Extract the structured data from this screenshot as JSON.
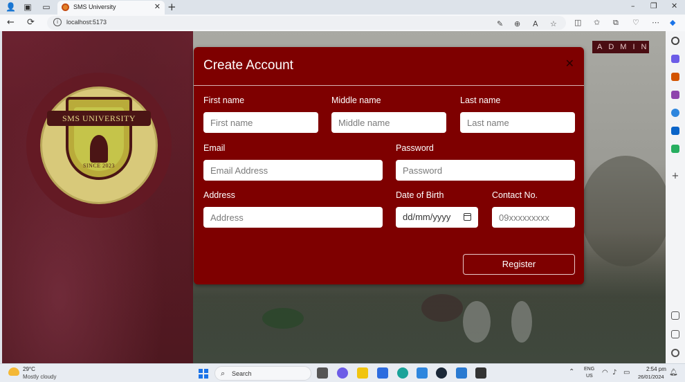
{
  "browser": {
    "tab_title": "SMS University",
    "tab_close": "✕",
    "new_tab": "+",
    "url": "localhost:5173",
    "window_controls": {
      "minimize": "–",
      "restore": "❐",
      "close": "✕"
    },
    "nav": {
      "back": "←",
      "reload": "⟳"
    }
  },
  "page": {
    "logo": {
      "banner": "SMS UNIVERSITY",
      "since": "SINCE 2023"
    },
    "admin_badge": "ADMIN"
  },
  "modal": {
    "title": "Create Account",
    "close_symbol": "✕",
    "fields": {
      "first_name": {
        "label": "First name",
        "placeholder": "First name"
      },
      "middle_name": {
        "label": "Middle name",
        "placeholder": "Middle name"
      },
      "last_name": {
        "label": "Last name",
        "placeholder": "Last name"
      },
      "email": {
        "label": "Email",
        "placeholder": "Email Address"
      },
      "password": {
        "label": "Password",
        "placeholder": "Password"
      },
      "address": {
        "label": "Address",
        "placeholder": "Address"
      },
      "dob": {
        "label": "Date of Birth",
        "value": "dd/mm/yyyy"
      },
      "contact": {
        "label": "Contact No.",
        "placeholder": "09xxxxxxxxx"
      }
    },
    "register_label": "Register"
  },
  "taskbar": {
    "weather": {
      "temp": "29°C",
      "desc": "Mostly cloudy",
      "icon": "partly-cloudy-icon"
    },
    "search_label": "Search",
    "lang": {
      "line1": "ENG",
      "line2": "US"
    },
    "time": "2:54 pm",
    "date": "26/01/2024"
  },
  "colors": {
    "modal_bg": "#7e0000",
    "admin_bg": "#4a0d12",
    "accent_blue": "#1a73e8"
  }
}
